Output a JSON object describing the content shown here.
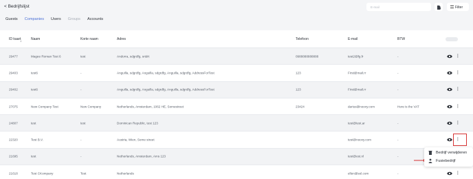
{
  "header": {
    "back_label": "< Bedrijfslijst",
    "search_placeholder": "E-mail",
    "filter_label": "Filter"
  },
  "tabs": [
    {
      "label": "Guests",
      "state": "normal"
    },
    {
      "label": "Companies",
      "state": "active"
    },
    {
      "label": "Users",
      "state": "normal"
    },
    {
      "label": "Groups",
      "state": "muted"
    },
    {
      "label": "Accounts",
      "state": "normal"
    }
  ],
  "table": {
    "columns": {
      "id": "ID kaart",
      "naam": "Naam",
      "kort": "Korte naam",
      "adres": "Adres",
      "tel": "Telefoon",
      "mail": "E-mail",
      "btw": "BTW"
    },
    "rows": [
      {
        "id": "29477",
        "naam": "Magee Roman Test 6",
        "kort": "test",
        "adres": "Andorra, sdgrdfg, srtdrt",
        "tel": "0988888888888",
        "mail": "test2@fg.fr",
        "btw": "-"
      },
      {
        "id": "29403",
        "naam": "test6",
        "kort": "-",
        "adres": "Anguilla, sdgrdfg, Anguilla, sdgrdfg, Anguilla, sdgrdfg, AddressForTest",
        "tel": "123",
        "mail": "First@mail.rr",
        "btw": "-"
      },
      {
        "id": "29402",
        "naam": "test6",
        "kort": "-",
        "adres": "Anguilla, sdgrdfg, Anguilla, sdgrdfg, Anguilla, sdgrdfg, AddressForTest",
        "tel": "123",
        "mail": "First@mail.rr",
        "btw": "-"
      },
      {
        "id": "27075",
        "naam": "New Company Test",
        "kort": "New Company",
        "adres": "Netherlands, Amsterdam, 1062 HE, Somestreet",
        "tel": "23424",
        "mail": "darius@noovy.com",
        "btw": "Here is the VAT"
      },
      {
        "id": "24807",
        "naam": "test",
        "kort": "test",
        "adres": "Dominican Republic, test 123",
        "tel": "",
        "mail": "test@test.ar",
        "btw": "-"
      },
      {
        "id": "22320",
        "naam": "Test B.V.",
        "kort": "-",
        "adres": "Austria, Wien, Some street",
        "tel": "",
        "mail": "test@noovy.com",
        "btw": "-"
      },
      {
        "id": "21695",
        "naam": "test",
        "kort": "-",
        "adres": "Netherlands, Amsterdam, Ams 123",
        "tel": "",
        "mail": "test@est.nl",
        "btw": "-"
      },
      {
        "id": "21618",
        "naam": "Test CKompany",
        "kort": "Test",
        "adres": "Netherlands",
        "tel": "",
        "mail": "ellen@sol.com",
        "btw": "-"
      }
    ]
  },
  "context_menu": {
    "items": [
      {
        "label": "Bedrijf verwijderen",
        "icon": "trash-icon"
      },
      {
        "label": "Fusiebedrijf",
        "icon": "person-merge-icon"
      }
    ]
  },
  "colors": {
    "accent": "#4a6fd6",
    "highlight": "#d63232"
  }
}
